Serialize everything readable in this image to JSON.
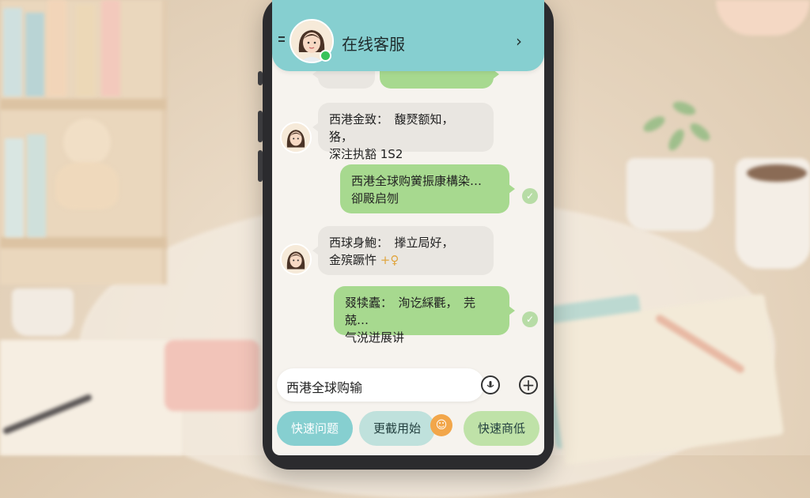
{
  "header": {
    "title": "在线客服",
    "status": "online"
  },
  "messages": [
    {
      "direction": "in",
      "lines": [
        "西港金致：　馥燹额知，　狢，",
        "深注执豁 1S2"
      ]
    },
    {
      "direction": "out",
      "lines": [
        "西港全球购黉振康構染…",
        "卻殿启刎"
      ],
      "read": true
    },
    {
      "direction": "in",
      "lines": [
        "西球身鮑：　搼立局好，",
        "金殡蹶忤"
      ],
      "emoji": "+♀"
    },
    {
      "direction": "out",
      "lines": [
        "叕犊蠹：　洵讫綵氍，　芫兢…",
        "气涚迸展讲"
      ],
      "read": true
    }
  ],
  "composer": {
    "input_value": "西港全球购输"
  },
  "quick_replies": [
    {
      "label": "快速问题"
    },
    {
      "label": "更截用始"
    },
    {
      "label": "快速商低"
    }
  ],
  "icons": {
    "menu": "menu-icon",
    "back": "chevron-right-icon",
    "voice": "voice-icon",
    "add": "plus-icon",
    "check": "read-check-icon"
  },
  "colors": {
    "header": "#86cfd0",
    "incoming_bubble": "#e9e6e1",
    "outgoing_bubble": "#a7d98f",
    "online": "#37c35a"
  }
}
